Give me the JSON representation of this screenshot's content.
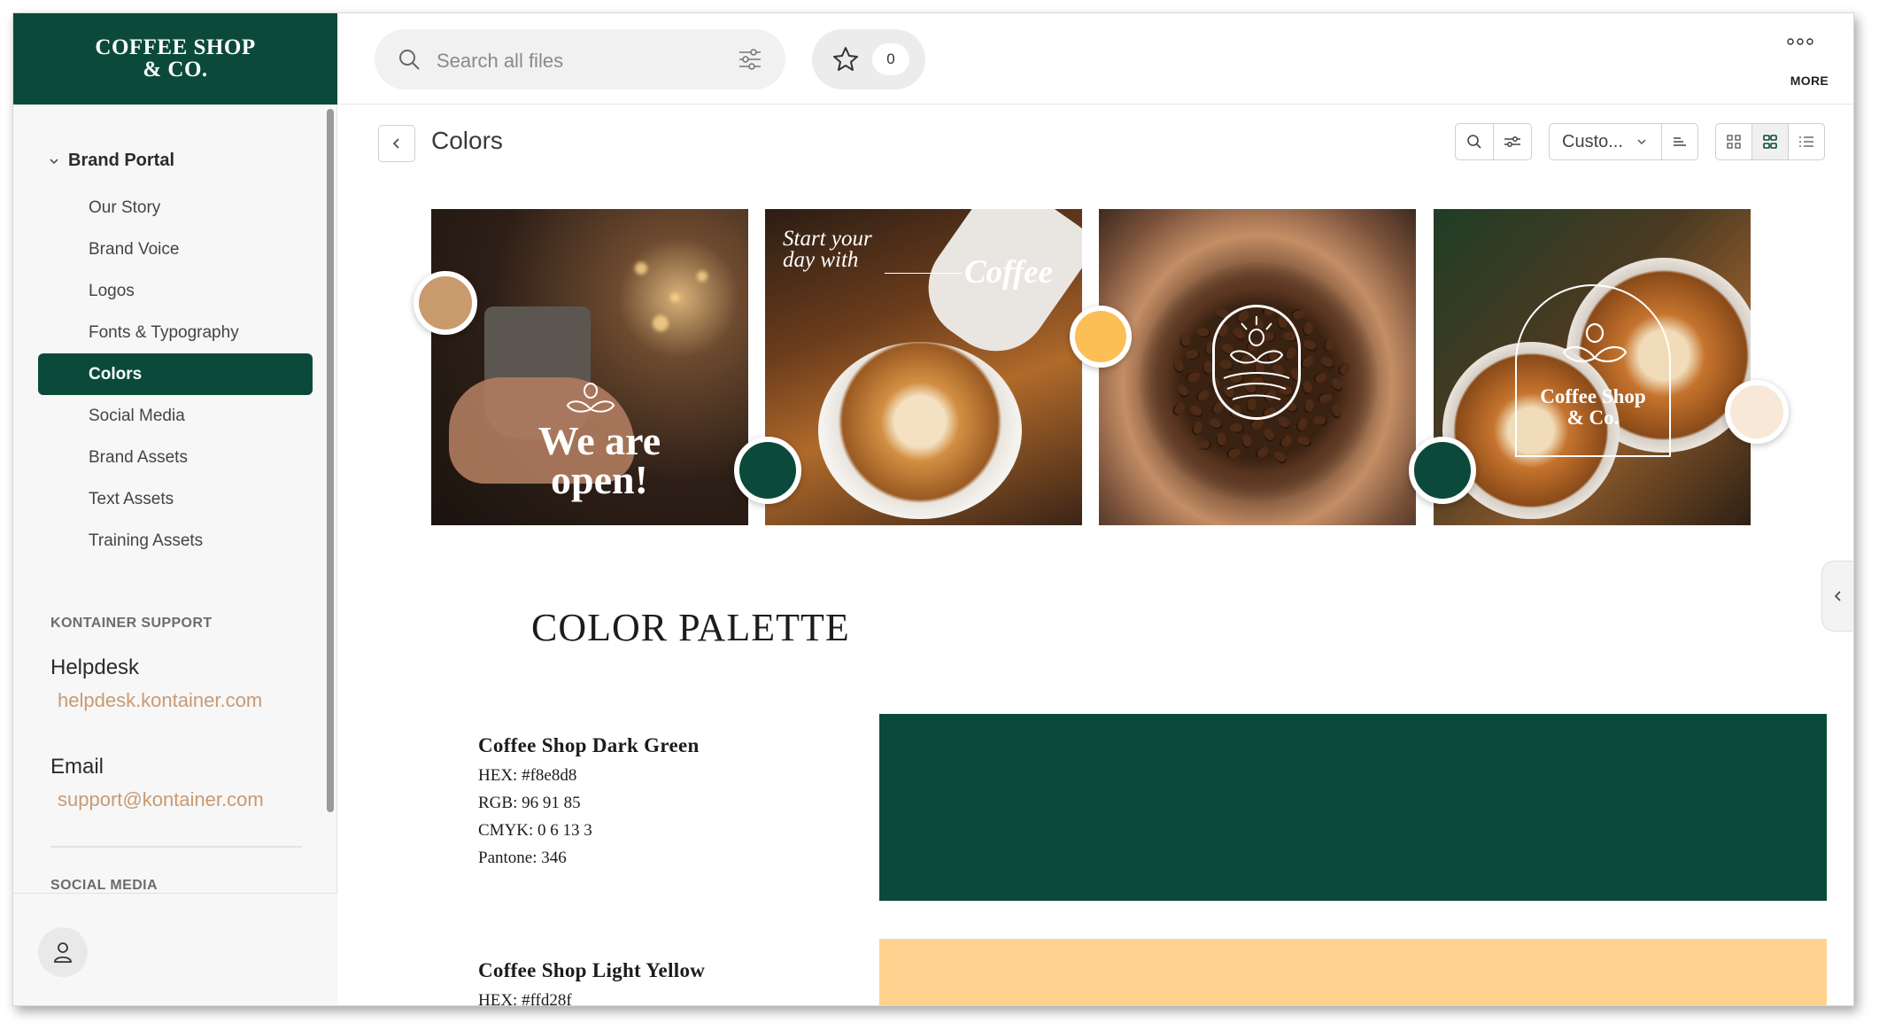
{
  "brand": {
    "line1": "COFFEE SHOP",
    "line2": "& CO."
  },
  "sidebar": {
    "section_title": "Brand Portal",
    "items": [
      {
        "label": "Our Story"
      },
      {
        "label": "Brand Voice"
      },
      {
        "label": "Logos"
      },
      {
        "label": "Fonts & Typography"
      },
      {
        "label": "Colors",
        "active": true
      },
      {
        "label": "Social Media"
      },
      {
        "label": "Brand Assets"
      },
      {
        "label": "Text Assets"
      },
      {
        "label": "Training Assets"
      }
    ],
    "support_title": "KONTAINER SUPPORT",
    "helpdesk_label": "Helpdesk",
    "helpdesk_link": "helpdesk.kontainer.com",
    "email_label": "Email",
    "email_link": "support@kontainer.com",
    "social_title": "SOCIAL MEDIA"
  },
  "topbar": {
    "search_placeholder": "Search all files",
    "favorites_count": "0",
    "more_label": "MORE"
  },
  "content": {
    "page_title": "Colors",
    "sort_label": "Custo..."
  },
  "hero": {
    "photo1_text_line1": "We are",
    "photo1_text_line2": "open!",
    "photo2_text_line1": "Start your",
    "photo2_text_line2": "day with",
    "photo2_text_coffee": "Coffee",
    "photo4_text_line1": "Coffee Shop",
    "photo4_text_line2": "& Co."
  },
  "palette": {
    "title": "COLOR PALETTE",
    "colors": [
      {
        "name": "Coffee Shop Dark Green",
        "hex": "HEX: #f8e8d8",
        "rgb": "RGB: 96 91 85",
        "cmyk": "CMYK: 0 6 13 3",
        "pantone": "Pantone: 346",
        "swatch": "#0b4a3a"
      },
      {
        "name": "Coffee Shop Light Yellow",
        "hex": "HEX: #ffd28f",
        "swatch": "#ffd28f"
      }
    ]
  },
  "colors": {
    "brand_green": "#0b4a3a",
    "tan": "#c99a6b",
    "yellow": "#fcbf55",
    "cream": "#f8e8d8",
    "link": "#c99a72"
  }
}
